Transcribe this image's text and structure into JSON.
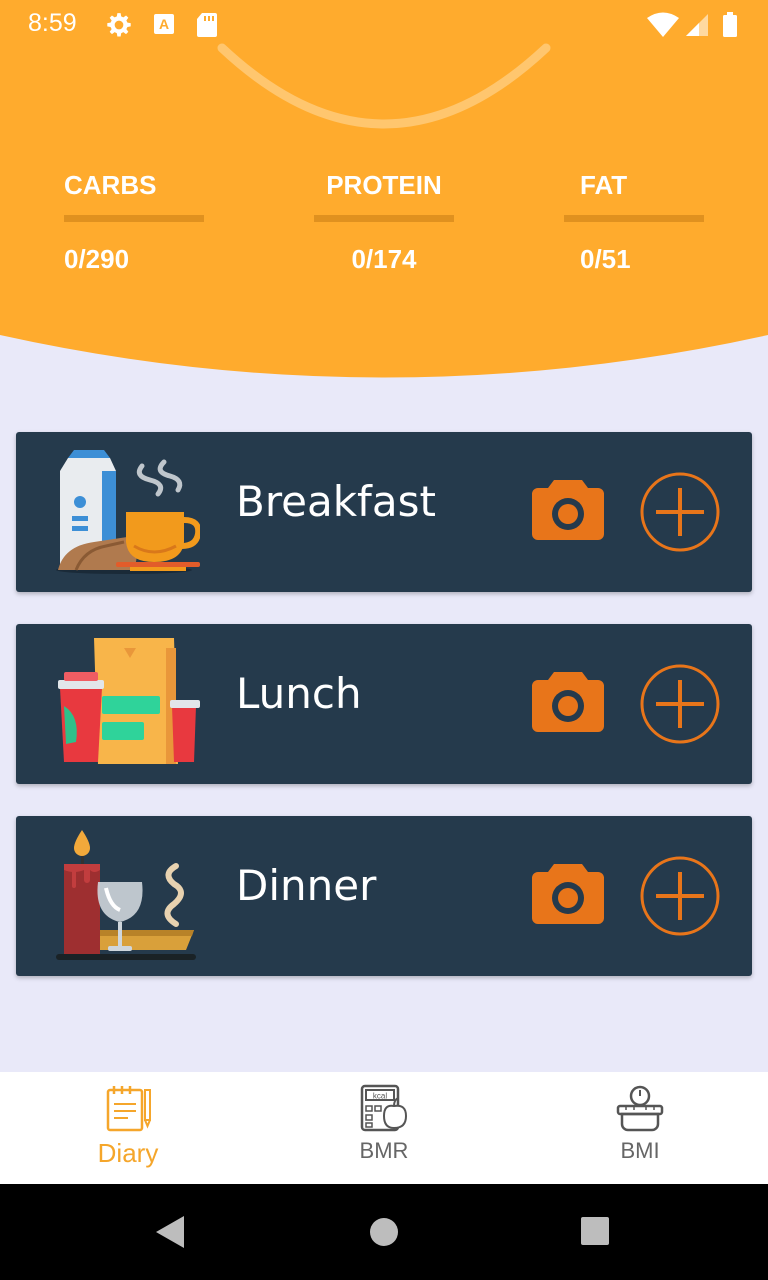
{
  "status_bar": {
    "time": "8:59",
    "icons": [
      "settings-icon",
      "a-icon",
      "sd-card-icon",
      "wifi-icon",
      "signal-icon",
      "battery-icon"
    ]
  },
  "colors": {
    "accent": "#f5a62b",
    "header_bg": "#ffab2d",
    "card_bg": "#253a4c",
    "page_bg": "#e9e9f9",
    "action_orange": "#e8751a"
  },
  "macros": [
    {
      "label": "CARBS",
      "value": "0/290"
    },
    {
      "label": "PROTEIN",
      "value": "0/174"
    },
    {
      "label": "FAT",
      "value": "0/51"
    }
  ],
  "meals": [
    {
      "title": "Breakfast",
      "illustration": "breakfast-illustration",
      "camera_icon": "camera-icon",
      "add_icon": "add-circle-icon"
    },
    {
      "title": "Lunch",
      "illustration": "lunch-illustration",
      "camera_icon": "camera-icon",
      "add_icon": "add-circle-icon"
    },
    {
      "title": "Dinner",
      "illustration": "dinner-illustration",
      "camera_icon": "camera-icon",
      "add_icon": "add-circle-icon"
    }
  ],
  "bottom_nav": [
    {
      "label": "Diary",
      "icon": "diary-icon",
      "active": true
    },
    {
      "label": "BMR",
      "icon": "bmr-calculator-icon",
      "active": false
    },
    {
      "label": "BMI",
      "icon": "bmi-scale-icon",
      "active": false
    }
  ],
  "system_nav": [
    "back-icon",
    "home-icon",
    "recents-icon"
  ]
}
